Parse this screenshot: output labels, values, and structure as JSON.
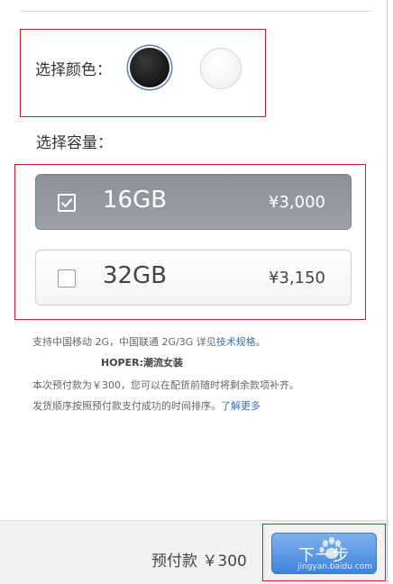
{
  "color_picker": {
    "label": "选择颜色：",
    "options": [
      {
        "name": "black",
        "hex": "#1f1f1f",
        "selected": true
      },
      {
        "name": "white",
        "hex": "#f7f7f7",
        "selected": false
      }
    ]
  },
  "capacity": {
    "label": "选择容量：",
    "options": [
      {
        "size": "16GB",
        "price": "¥3,000",
        "selected": true
      },
      {
        "size": "32GB",
        "price": "¥3,150",
        "selected": false
      }
    ]
  },
  "info": {
    "line1_prefix": "支持中国移动 2G，中国联通 2G/3G 详见",
    "line1_link": "技术规格",
    "line1_suffix": "。",
    "watermark": "HOPER:潮流女装",
    "line2": "本次预付款为￥300，您可以在配货前随时将剩余款项补齐。",
    "line3_prefix": "发货顺序按照预付款支付成功的时间排序。",
    "line3_link": "了解更多"
  },
  "footer": {
    "deposit_label": "预付款 ￥300",
    "next_label": "下一步",
    "baidu_watermark": "jingyan.baidu.com"
  },
  "colors": {
    "accent_blue": "#3f83dd",
    "highlight_red": "#c0262d",
    "selected_gray": "#9499a0",
    "link_blue": "#3a6fb3"
  }
}
